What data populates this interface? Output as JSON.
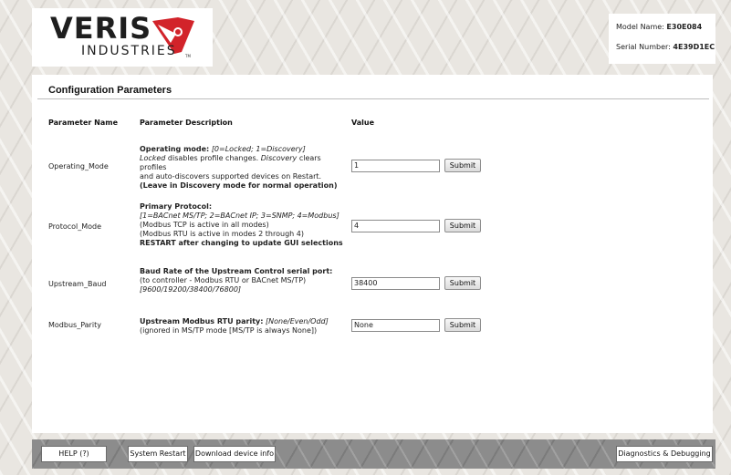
{
  "brand": {
    "name": "VERIS",
    "subtitle": "INDUSTRIES",
    "tm": "TM"
  },
  "device": {
    "model_label": "Model Name:",
    "model_value": "E30E084",
    "serial_label": "Serial Number:",
    "serial_value": "4E39D1EC"
  },
  "section_title": "Configuration Parameters",
  "columns": {
    "name": "Parameter Name",
    "description": "Parameter Description",
    "value": "Value"
  },
  "params": [
    {
      "name": "Operating_Mode",
      "title": "Operating mode:",
      "title_note": "[0=Locked; 1=Discovery]",
      "line2_a": "Locked",
      "line2_b": " disables profile changes. ",
      "line2_c": "Discovery",
      "line2_d": " clears profiles",
      "line3": "and auto-discovers supported devices on Restart.",
      "line4": "(Leave in Discovery mode for normal operation)",
      "value": "1",
      "submit": "Submit"
    },
    {
      "name": "Protocol_Mode",
      "title": "Primary Protocol:",
      "line2": "[1=BACnet MS/TP; 2=BACnet IP; 3=SNMP; 4=Modbus]",
      "line3": "(Modbus TCP is active in all modes)",
      "line4": "(Modbus RTU is active in modes 2 through 4)",
      "line5": "RESTART after changing to update GUI selections",
      "value": "4",
      "submit": "Submit"
    },
    {
      "name": "Upstream_Baud",
      "title": "Baud Rate of the Upstream Control serial port:",
      "line2": "(to controller - Modbus RTU or BACnet MS/TP)",
      "line3": "[9600/19200/38400/76800]",
      "value": "38400",
      "submit": "Submit"
    },
    {
      "name": "Modbus_Parity",
      "title": "Upstream Modbus RTU parity:",
      "title_note": "[None/Even/Odd]",
      "line2": "(ignored in MS/TP mode [MS/TP is always None])",
      "value": "None",
      "submit": "Submit"
    }
  ],
  "footer": {
    "help": "HELP (?)",
    "restart": "System Restart",
    "download": "Download device info",
    "diagnostics": "Diagnostics & Debugging"
  },
  "colors": {
    "logo_red": "#d2232a",
    "footer_gray": "#8c8c8c"
  }
}
